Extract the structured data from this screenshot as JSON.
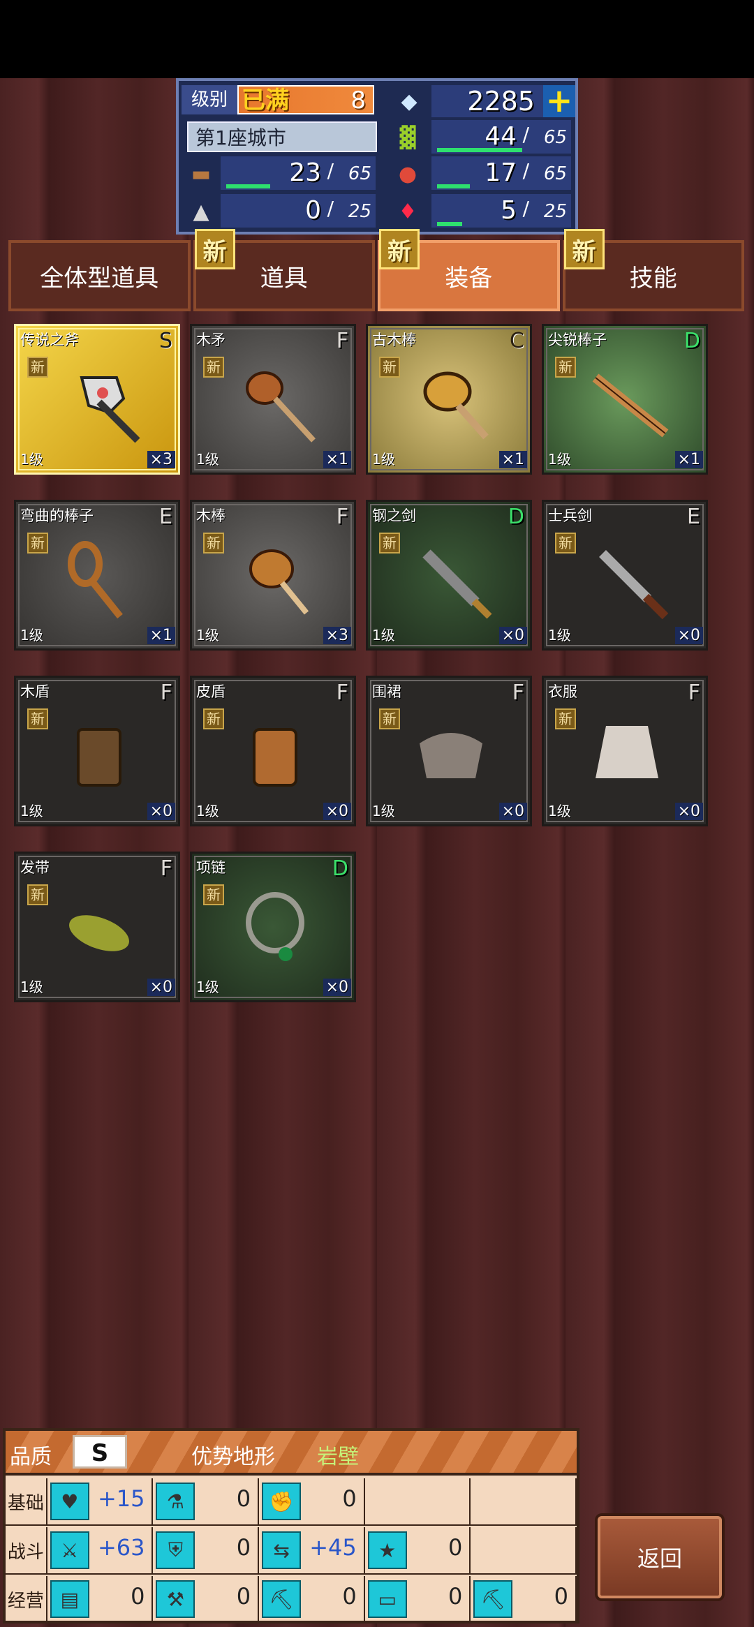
{
  "hud": {
    "level_label": "级别",
    "level_cap": "已满",
    "level_value": "8",
    "gems": "2285",
    "city": "第1座城市",
    "wood": {
      "value": "23",
      "max": "65",
      "fill": 0.35
    },
    "stone": {
      "value": "0",
      "max": "25",
      "fill": 0
    },
    "grain": {
      "value": "44",
      "max": "65",
      "fill": 0.68
    },
    "food": {
      "value": "17",
      "max": "65",
      "fill": 0.26
    },
    "ruby": {
      "value": "5",
      "max": "25",
      "fill": 0.2
    },
    "slash": "/"
  },
  "tabs": [
    {
      "label": "全体型道具",
      "new": false
    },
    {
      "label": "道具",
      "new": true
    },
    {
      "label": "装备",
      "new": true,
      "active": true
    },
    {
      "label": "技能",
      "new": true
    }
  ],
  "new_badge": "新",
  "items": [
    {
      "name": "传说之斧",
      "grade": "S",
      "level": "1级",
      "count": "×3",
      "quality": "s",
      "icon": "axe-icon"
    },
    {
      "name": "木矛",
      "grade": "F",
      "level": "1级",
      "count": "×1",
      "quality": "f",
      "icon": "wooden-spear-icon"
    },
    {
      "name": "古木棒",
      "grade": "C",
      "level": "1级",
      "count": "×1",
      "quality": "c",
      "icon": "ancient-club-icon"
    },
    {
      "name": "尖锐棒子",
      "grade": "D",
      "level": "1级",
      "count": "×1",
      "quality": "d",
      "icon": "sharp-stick-icon"
    },
    {
      "name": "弯曲的棒子",
      "grade": "E",
      "level": "1级",
      "count": "×1",
      "quality": "e",
      "icon": "bent-stick-icon"
    },
    {
      "name": "木棒",
      "grade": "F",
      "level": "1级",
      "count": "×3",
      "quality": "f",
      "icon": "wooden-club-icon"
    },
    {
      "name": "钢之剑",
      "grade": "D",
      "level": "1级",
      "count": "×0",
      "quality": "d",
      "icon": "steel-sword-icon"
    },
    {
      "name": "士兵剑",
      "grade": "E",
      "level": "1级",
      "count": "×0",
      "quality": "e",
      "icon": "soldier-sword-icon"
    },
    {
      "name": "木盾",
      "grade": "F",
      "level": "1级",
      "count": "×0",
      "quality": "f",
      "icon": "wooden-shield-icon"
    },
    {
      "name": "皮盾",
      "grade": "F",
      "level": "1级",
      "count": "×0",
      "quality": "f",
      "icon": "leather-shield-icon"
    },
    {
      "name": "围裙",
      "grade": "F",
      "level": "1级",
      "count": "×0",
      "quality": "f",
      "icon": "apron-icon"
    },
    {
      "name": "衣服",
      "grade": "F",
      "level": "1级",
      "count": "×0",
      "quality": "f",
      "icon": "clothes-icon"
    },
    {
      "name": "发带",
      "grade": "F",
      "level": "1级",
      "count": "×0",
      "quality": "f",
      "icon": "headband-icon"
    },
    {
      "name": "项链",
      "grade": "D",
      "level": "1级",
      "count": "×0",
      "quality": "d",
      "icon": "necklace-icon"
    }
  ],
  "panel": {
    "quality_label": "品质",
    "quality_value": "S",
    "terrain_label": "优势地形",
    "terrain_value": "岩壁",
    "rows": [
      {
        "label": "基础",
        "cells": [
          {
            "icon": "heart-icon",
            "value": "+15"
          },
          {
            "icon": "potion-icon",
            "value": "0"
          },
          {
            "icon": "strength-icon",
            "value": "0"
          },
          {
            "icon": "",
            "value": ""
          },
          {
            "icon": "",
            "value": ""
          }
        ]
      },
      {
        "label": "战斗",
        "cells": [
          {
            "icon": "sword-attack-icon",
            "value": "+63"
          },
          {
            "icon": "shield-defense-icon",
            "value": "0"
          },
          {
            "icon": "speed-icon",
            "value": "+45"
          },
          {
            "icon": "star-icon",
            "value": "0"
          },
          {
            "icon": "",
            "value": ""
          }
        ]
      },
      {
        "label": "经营",
        "cells": [
          {
            "icon": "book-icon",
            "value": "0"
          },
          {
            "icon": "hammer-icon",
            "value": "0"
          },
          {
            "icon": "shovel-icon",
            "value": "0"
          },
          {
            "icon": "basket-icon",
            "value": "0"
          },
          {
            "icon": "pickaxe-icon",
            "value": "0"
          }
        ]
      }
    ]
  },
  "back_label": "返回"
}
